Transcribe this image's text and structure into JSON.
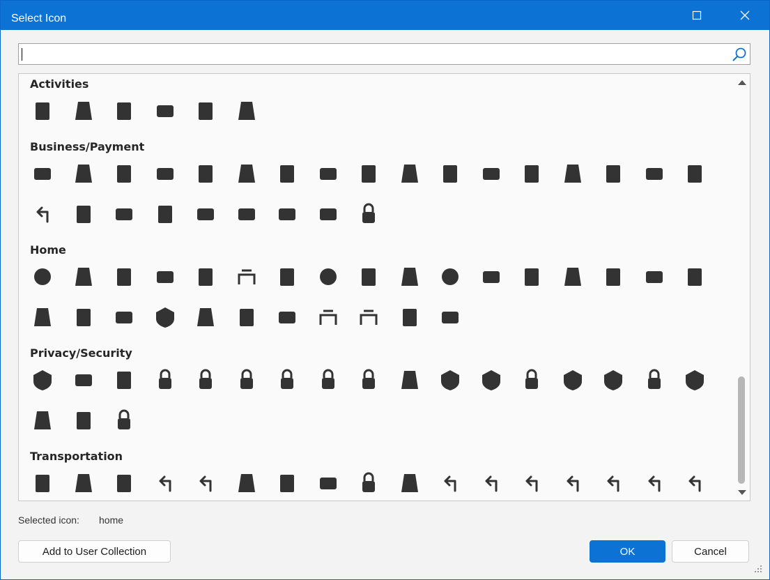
{
  "window": {
    "title": "Select Icon"
  },
  "search": {
    "value": "",
    "placeholder": ""
  },
  "categories": [
    {
      "label": "Activities",
      "icons": [
        "fishing-hook-icon",
        "roller-skate-icon",
        "scoreboard-icon",
        "skiing-icon",
        "figure-skating-icon",
        "martial-arts-icon"
      ]
    },
    {
      "label": "Business/Payment",
      "icons": [
        "card-add-icon",
        "barcode-scanner-icon",
        "candlestick-chart-icon",
        "cash-register-icon",
        "bitcoin-icon",
        "currency-exchange-icon",
        "franc-icon",
        "lira-icon",
        "pound-icon",
        "ruble-icon",
        "rupee-icon",
        "yen-icon",
        "yuan-icon",
        "building-add-icon",
        "forklift-icon",
        "bulldozer-icon",
        "pallet-box-icon",
        "cart-arrow-icon",
        "trend-down-icon",
        "trolley-icon",
        "zoom-chart-icon",
        "wallet-icon",
        "gift-card-icon",
        "ribbon-card-icon",
        "briefcase-icon",
        "briefcase-clock-icon"
      ]
    },
    {
      "label": "Home",
      "icons": [
        "compass-spark-icon",
        "shelf-icon",
        "bookcase-icon",
        "cabinet-icon",
        "closet-icon",
        "desk-icon",
        "fast-charge-icon",
        "flash-icon",
        "video-add-icon",
        "location-wifi-icon",
        "eco-flash-icon",
        "cooktop-icon",
        "speaker-icon",
        "lamp-icon",
        "fan-off-icon",
        "tank-icon",
        "bag-icon",
        "oven-icon",
        "monitor-stand-icon",
        "bunk-bed-icon",
        "shield-moon-icon",
        "door-icon",
        "face-scan-icon",
        "washer-icon",
        "table-round-icon",
        "table-icon",
        "gate-icon",
        "fence-icon"
      ]
    },
    {
      "label": "Privacy/Security",
      "icons": [
        "bank-shield-icon",
        "id-card-icon",
        "eye-speed-icon",
        "lock-add-icon",
        "lock-icon",
        "lock-clock-icon",
        "lock-open-icon",
        "lock-closed-icon",
        "lock-person-icon",
        "restore-icon",
        "shield-search-icon",
        "shield-info-icon",
        "lock-line-icon",
        "shield-half-icon",
        "shield-icon",
        "sync-lock-icon",
        "shield-check-icon",
        "key-icon",
        "eye-off-icon",
        "wifi-lock-icon"
      ]
    },
    {
      "label": "Transportation",
      "icons": [
        "ferry-icon",
        "train-icon",
        "car-alert-icon",
        "turn-left-split-icon",
        "turn-right-split-icon",
        "no-luggage-icon",
        "bicycle-icon",
        "car-check-icon",
        "clock-signal-icon",
        "map-pin-icon",
        "turn-left-icon",
        "turn-right-icon",
        "arrow-up-left-icon",
        "arrow-up-right-icon",
        "slight-left-icon",
        "slight-right-icon",
        "u-turn-icon"
      ]
    }
  ],
  "selected": {
    "label": "Selected icon:",
    "value": "home"
  },
  "buttons": {
    "add": "Add to User Collection",
    "ok": "OK",
    "cancel": "Cancel"
  },
  "colors": {
    "accent": "#0c72d4",
    "icon": "#333333"
  }
}
